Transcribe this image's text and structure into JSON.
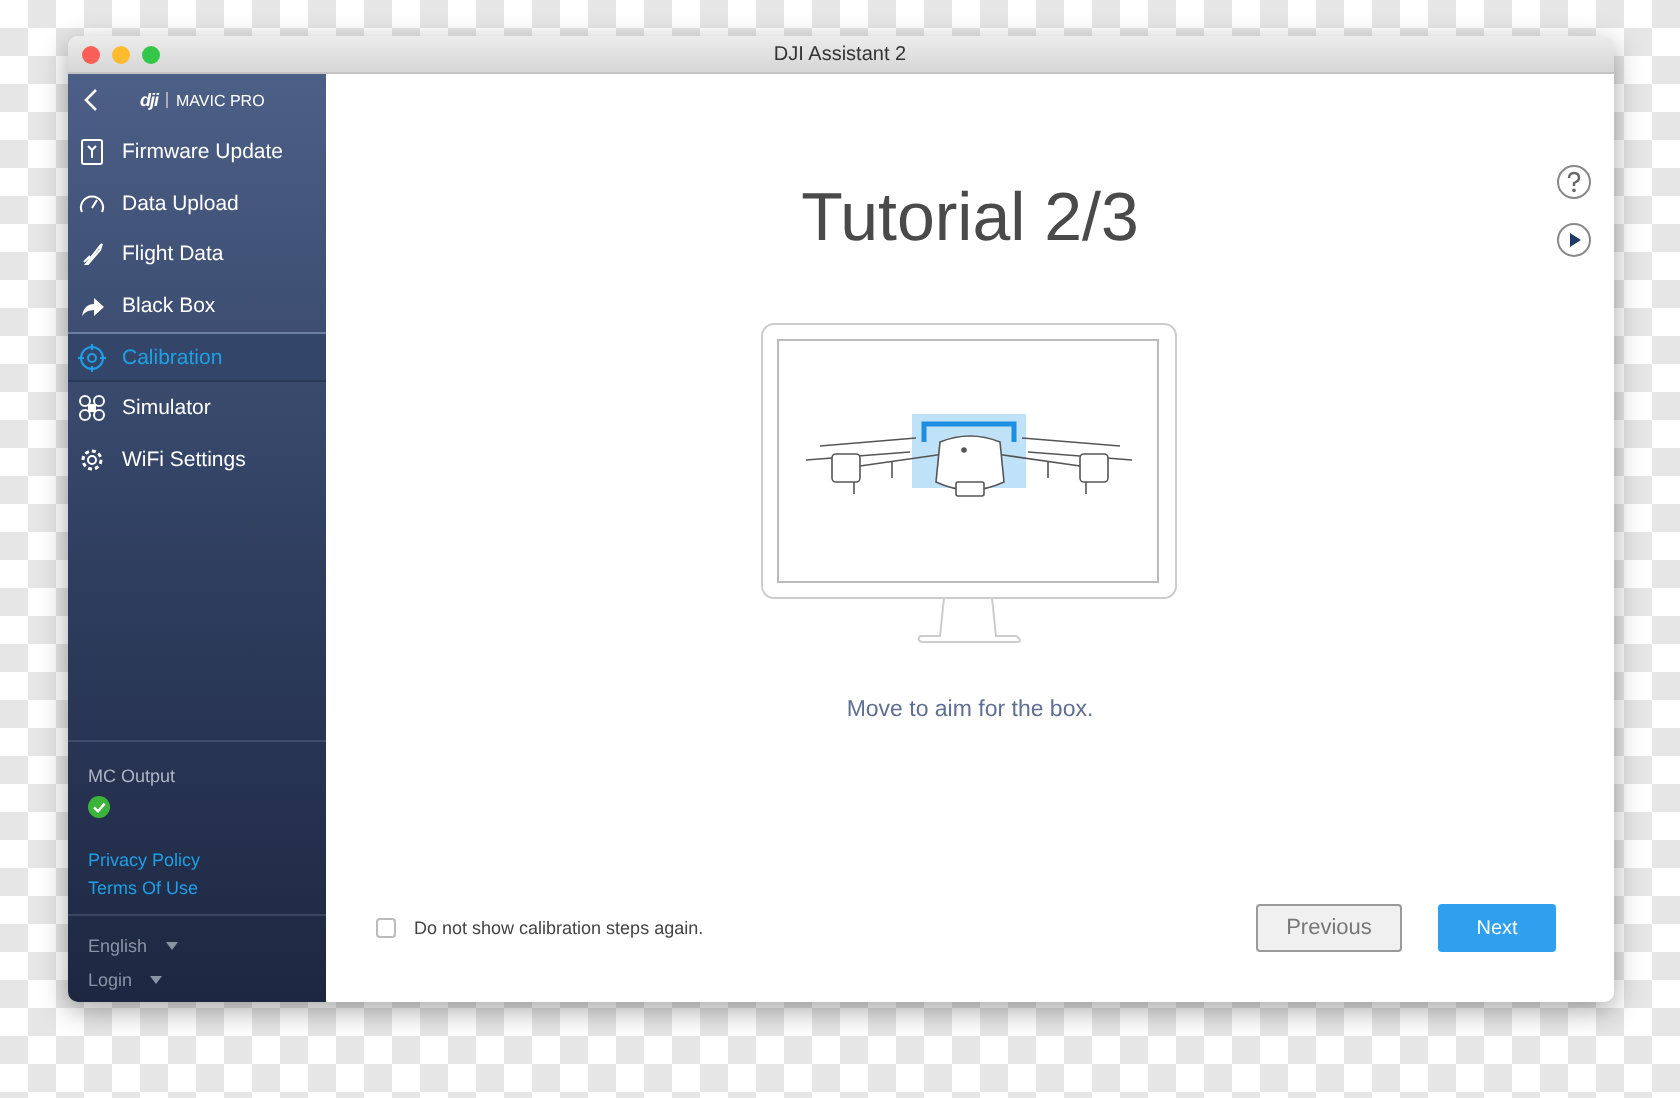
{
  "window": {
    "title": "DJI Assistant 2"
  },
  "sidebar": {
    "logo": "dji",
    "product": "MAVIC PRO",
    "items": [
      {
        "label": "Firmware Update",
        "selected": false
      },
      {
        "label": "Data Upload",
        "selected": false
      },
      {
        "label": "Flight Data",
        "selected": false
      },
      {
        "label": "Black Box",
        "selected": false
      },
      {
        "label": "Calibration",
        "selected": true
      },
      {
        "label": "Simulator",
        "selected": false
      },
      {
        "label": "WiFi Settings",
        "selected": false
      }
    ],
    "status": {
      "label": "MC Output",
      "ok": true
    },
    "links": [
      "Privacy Policy",
      "Terms Of Use"
    ],
    "menus": [
      "English",
      "Login"
    ]
  },
  "main": {
    "title": "Tutorial 2/3",
    "caption": "Move to aim for the box.",
    "checkbox": {
      "label": "Do not show calibration steps again.",
      "checked": false
    },
    "buttons": [
      {
        "label": "Previous",
        "kind": "secondary"
      },
      {
        "label": "Next",
        "kind": "primary"
      }
    ]
  }
}
